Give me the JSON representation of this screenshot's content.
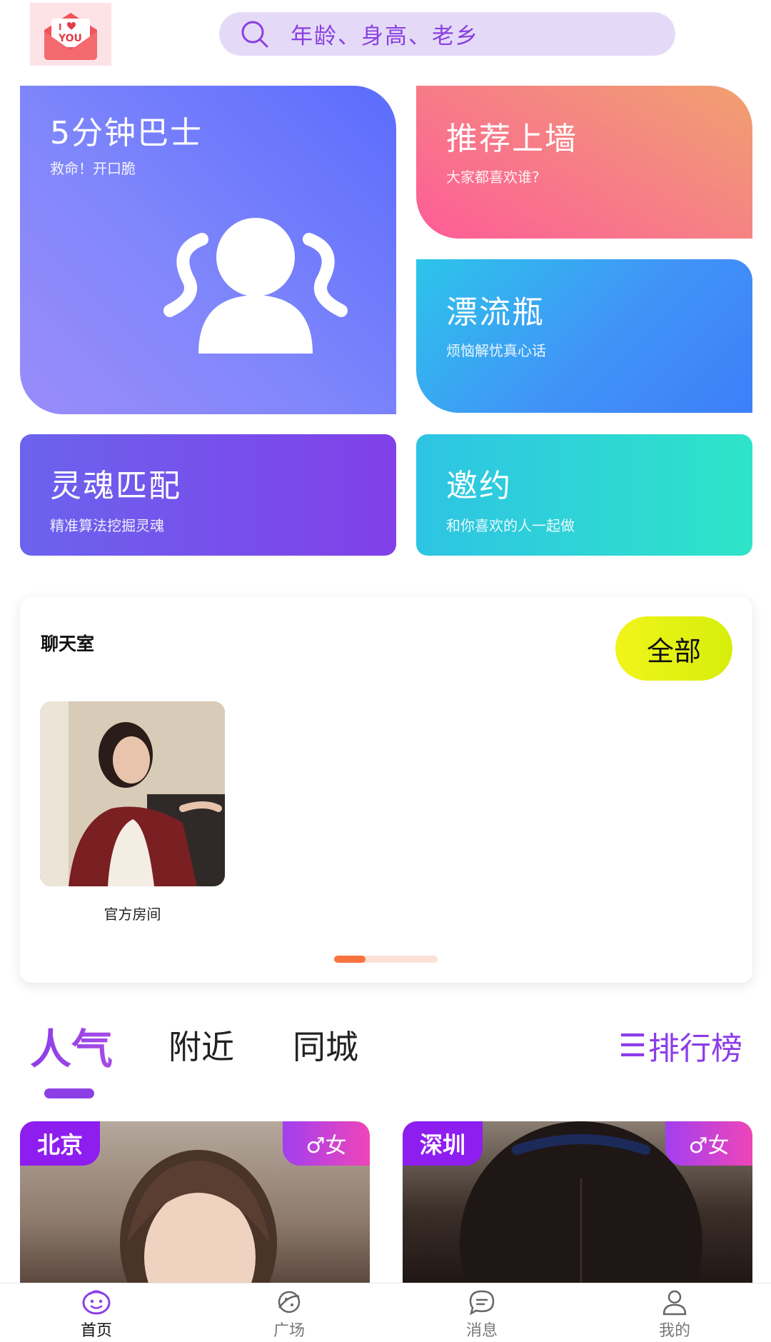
{
  "header": {
    "search_placeholder": "年龄、身高、老乡"
  },
  "features": {
    "bus": {
      "title": "5分钟巴士",
      "subtitle": "救命！开口脆"
    },
    "wall": {
      "title": "推荐上墙",
      "subtitle": "大家都喜欢谁?"
    },
    "bottle": {
      "title": "漂流瓶",
      "subtitle": "烦恼解忧真心话"
    },
    "soul": {
      "title": "灵魂匹配",
      "subtitle": "精准算法挖掘灵魂"
    },
    "invite": {
      "title": "邀约",
      "subtitle": "和你喜欢的人一起做"
    }
  },
  "chatroom": {
    "title": "聊天室",
    "all_label": "全部",
    "rooms": [
      {
        "name": "官方房间"
      }
    ],
    "pager_progress": 0.3
  },
  "tabs": {
    "items": [
      {
        "label": "人气",
        "active": true
      },
      {
        "label": "附近",
        "active": false
      },
      {
        "label": "同城",
        "active": false
      }
    ],
    "rank_label": "排行榜"
  },
  "profiles": [
    {
      "city": "北京",
      "gender": "♂女"
    },
    {
      "city": "深圳",
      "gender": "♂女"
    }
  ],
  "bottom_nav": [
    {
      "label": "首页",
      "icon": "home-face-icon",
      "active": true
    },
    {
      "label": "广场",
      "icon": "planet-icon",
      "active": false
    },
    {
      "label": "消息",
      "icon": "message-icon",
      "active": false
    },
    {
      "label": "我的",
      "icon": "user-icon",
      "active": false
    }
  ],
  "colors": {
    "accent": "#8c3de9",
    "search_bg": "#e4daf8",
    "all_button": "#e9f212",
    "pager": "#f9733f"
  }
}
